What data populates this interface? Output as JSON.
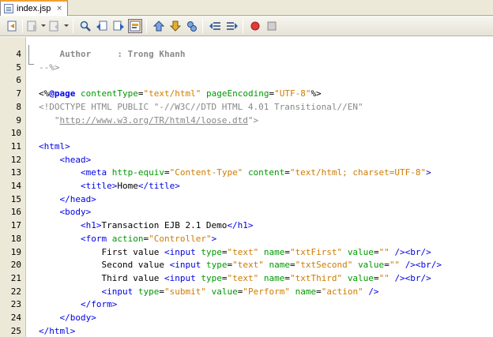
{
  "tab": {
    "label": "index.jsp",
    "close": "×"
  },
  "toolbar": {
    "buttons": [
      "back-to-last-edit-icon",
      "history-icon",
      "forward-history-icon",
      "find-icon",
      "find-previous-icon",
      "find-next-icon",
      "toggle-highlight-icon",
      "toggle-bookmark-icon",
      "previous-bookmark-icon",
      "next-bookmark-icon",
      "shift-left-icon",
      "shift-right-icon",
      "record-macro-icon",
      "stop-macro-icon"
    ]
  },
  "editor": {
    "lines": [
      {
        "n": "4",
        "tokens": [
          {
            "c": "t-cmt",
            "t": "    "
          },
          {
            "c": "t-cmt t-bold",
            "t": "Author     : Trong Khanh"
          }
        ]
      },
      {
        "n": "5",
        "tokens": [
          {
            "c": "t-cmt",
            "t": "--%>"
          }
        ]
      },
      {
        "n": "6",
        "tokens": []
      },
      {
        "n": "7",
        "tokens": [
          {
            "c": "t-jsp",
            "t": "<%"
          },
          {
            "c": "t-jspkw",
            "t": "@page"
          },
          {
            "c": "t-text",
            "t": " "
          },
          {
            "c": "t-attr",
            "t": "contentType"
          },
          {
            "c": "t-text",
            "t": "="
          },
          {
            "c": "t-val",
            "t": "\"text/html\""
          },
          {
            "c": "t-text",
            "t": " "
          },
          {
            "c": "t-attr",
            "t": "pageEncoding"
          },
          {
            "c": "t-text",
            "t": "="
          },
          {
            "c": "t-val",
            "t": "\"UTF-8\""
          },
          {
            "c": "t-jsp",
            "t": "%>"
          }
        ]
      },
      {
        "n": "8",
        "tokens": [
          {
            "c": "t-doctype",
            "t": "<!DOCTYPE HTML PUBLIC \"-//W3C//DTD HTML 4.01 Transitional//EN\""
          }
        ]
      },
      {
        "n": "9",
        "tokens": [
          {
            "c": "t-doctype",
            "t": "   \""
          },
          {
            "c": "t-link",
            "t": "http://www.w3.org/TR/html4/loose.dtd"
          },
          {
            "c": "t-doctype",
            "t": "\">"
          }
        ]
      },
      {
        "n": "10",
        "tokens": []
      },
      {
        "n": "11",
        "tokens": [
          {
            "c": "t-tag",
            "t": "<html>"
          }
        ]
      },
      {
        "n": "12",
        "tokens": [
          {
            "c": "t-text",
            "t": "    "
          },
          {
            "c": "t-tag",
            "t": "<head>"
          }
        ]
      },
      {
        "n": "13",
        "tokens": [
          {
            "c": "t-text",
            "t": "        "
          },
          {
            "c": "t-tag",
            "t": "<meta"
          },
          {
            "c": "t-text",
            "t": " "
          },
          {
            "c": "t-attr",
            "t": "http-equiv"
          },
          {
            "c": "t-text",
            "t": "="
          },
          {
            "c": "t-val",
            "t": "\"Content-Type\""
          },
          {
            "c": "t-text",
            "t": " "
          },
          {
            "c": "t-attr",
            "t": "content"
          },
          {
            "c": "t-text",
            "t": "="
          },
          {
            "c": "t-val",
            "t": "\"text/html; charset=UTF-8\""
          },
          {
            "c": "t-tag",
            "t": ">"
          }
        ]
      },
      {
        "n": "14",
        "tokens": [
          {
            "c": "t-text",
            "t": "        "
          },
          {
            "c": "t-tag",
            "t": "<title>"
          },
          {
            "c": "t-text",
            "t": "Home"
          },
          {
            "c": "t-tag",
            "t": "</title>"
          }
        ]
      },
      {
        "n": "15",
        "tokens": [
          {
            "c": "t-text",
            "t": "    "
          },
          {
            "c": "t-tag",
            "t": "</head>"
          }
        ]
      },
      {
        "n": "16",
        "tokens": [
          {
            "c": "t-text",
            "t": "    "
          },
          {
            "c": "t-tag",
            "t": "<body>"
          }
        ]
      },
      {
        "n": "17",
        "tokens": [
          {
            "c": "t-text",
            "t": "        "
          },
          {
            "c": "t-tag",
            "t": "<h1>"
          },
          {
            "c": "t-text",
            "t": "Transaction EJB 2.1 Demo"
          },
          {
            "c": "t-tag",
            "t": "</h1>"
          }
        ]
      },
      {
        "n": "18",
        "tokens": [
          {
            "c": "t-text",
            "t": "        "
          },
          {
            "c": "t-tag",
            "t": "<form"
          },
          {
            "c": "t-text",
            "t": " "
          },
          {
            "c": "t-attr",
            "t": "action"
          },
          {
            "c": "t-text",
            "t": "="
          },
          {
            "c": "t-val",
            "t": "\"Controller\""
          },
          {
            "c": "t-tag",
            "t": ">"
          }
        ]
      },
      {
        "n": "19",
        "tokens": [
          {
            "c": "t-text",
            "t": "            First value "
          },
          {
            "c": "t-tag",
            "t": "<input"
          },
          {
            "c": "t-text",
            "t": " "
          },
          {
            "c": "t-attr",
            "t": "type"
          },
          {
            "c": "t-text",
            "t": "="
          },
          {
            "c": "t-val",
            "t": "\"text\""
          },
          {
            "c": "t-text",
            "t": " "
          },
          {
            "c": "t-attr",
            "t": "name"
          },
          {
            "c": "t-text",
            "t": "="
          },
          {
            "c": "t-val",
            "t": "\"txtFirst\""
          },
          {
            "c": "t-text",
            "t": " "
          },
          {
            "c": "t-attr",
            "t": "value"
          },
          {
            "c": "t-text",
            "t": "="
          },
          {
            "c": "t-val",
            "t": "\"\""
          },
          {
            "c": "t-text",
            "t": " "
          },
          {
            "c": "t-tag",
            "t": "/><br/>"
          }
        ]
      },
      {
        "n": "20",
        "tokens": [
          {
            "c": "t-text",
            "t": "            Second value "
          },
          {
            "c": "t-tag",
            "t": "<input"
          },
          {
            "c": "t-text",
            "t": " "
          },
          {
            "c": "t-attr",
            "t": "type"
          },
          {
            "c": "t-text",
            "t": "="
          },
          {
            "c": "t-val",
            "t": "\"text\""
          },
          {
            "c": "t-text",
            "t": " "
          },
          {
            "c": "t-attr",
            "t": "name"
          },
          {
            "c": "t-text",
            "t": "="
          },
          {
            "c": "t-val",
            "t": "\"txtSecond\""
          },
          {
            "c": "t-text",
            "t": " "
          },
          {
            "c": "t-attr",
            "t": "value"
          },
          {
            "c": "t-text",
            "t": "="
          },
          {
            "c": "t-val",
            "t": "\"\""
          },
          {
            "c": "t-text",
            "t": " "
          },
          {
            "c": "t-tag",
            "t": "/><br/>"
          }
        ]
      },
      {
        "n": "21",
        "tokens": [
          {
            "c": "t-text",
            "t": "            Third value "
          },
          {
            "c": "t-tag",
            "t": "<input"
          },
          {
            "c": "t-text",
            "t": " "
          },
          {
            "c": "t-attr",
            "t": "type"
          },
          {
            "c": "t-text",
            "t": "="
          },
          {
            "c": "t-val",
            "t": "\"text\""
          },
          {
            "c": "t-text",
            "t": " "
          },
          {
            "c": "t-attr",
            "t": "name"
          },
          {
            "c": "t-text",
            "t": "="
          },
          {
            "c": "t-val",
            "t": "\"txtThird\""
          },
          {
            "c": "t-text",
            "t": " "
          },
          {
            "c": "t-attr",
            "t": "value"
          },
          {
            "c": "t-text",
            "t": "="
          },
          {
            "c": "t-val",
            "t": "\"\""
          },
          {
            "c": "t-text",
            "t": " "
          },
          {
            "c": "t-tag",
            "t": "/><br/>"
          }
        ]
      },
      {
        "n": "22",
        "tokens": [
          {
            "c": "t-text",
            "t": "            "
          },
          {
            "c": "t-tag",
            "t": "<input"
          },
          {
            "c": "t-text",
            "t": " "
          },
          {
            "c": "t-attr",
            "t": "type"
          },
          {
            "c": "t-text",
            "t": "="
          },
          {
            "c": "t-val",
            "t": "\"submit\""
          },
          {
            "c": "t-text",
            "t": " "
          },
          {
            "c": "t-attr",
            "t": "value"
          },
          {
            "c": "t-text",
            "t": "="
          },
          {
            "c": "t-val",
            "t": "\"Perform\""
          },
          {
            "c": "t-text",
            "t": " "
          },
          {
            "c": "t-attr",
            "t": "name"
          },
          {
            "c": "t-text",
            "t": "="
          },
          {
            "c": "t-val",
            "t": "\"action\""
          },
          {
            "c": "t-text",
            "t": " "
          },
          {
            "c": "t-tag",
            "t": "/>"
          }
        ]
      },
      {
        "n": "23",
        "tokens": [
          {
            "c": "t-text",
            "t": "        "
          },
          {
            "c": "t-tag",
            "t": "</form>"
          }
        ]
      },
      {
        "n": "24",
        "tokens": [
          {
            "c": "t-text",
            "t": "    "
          },
          {
            "c": "t-tag",
            "t": "</body>"
          }
        ]
      },
      {
        "n": "25",
        "tokens": [
          {
            "c": "t-tag",
            "t": "</html>"
          }
        ]
      }
    ]
  }
}
